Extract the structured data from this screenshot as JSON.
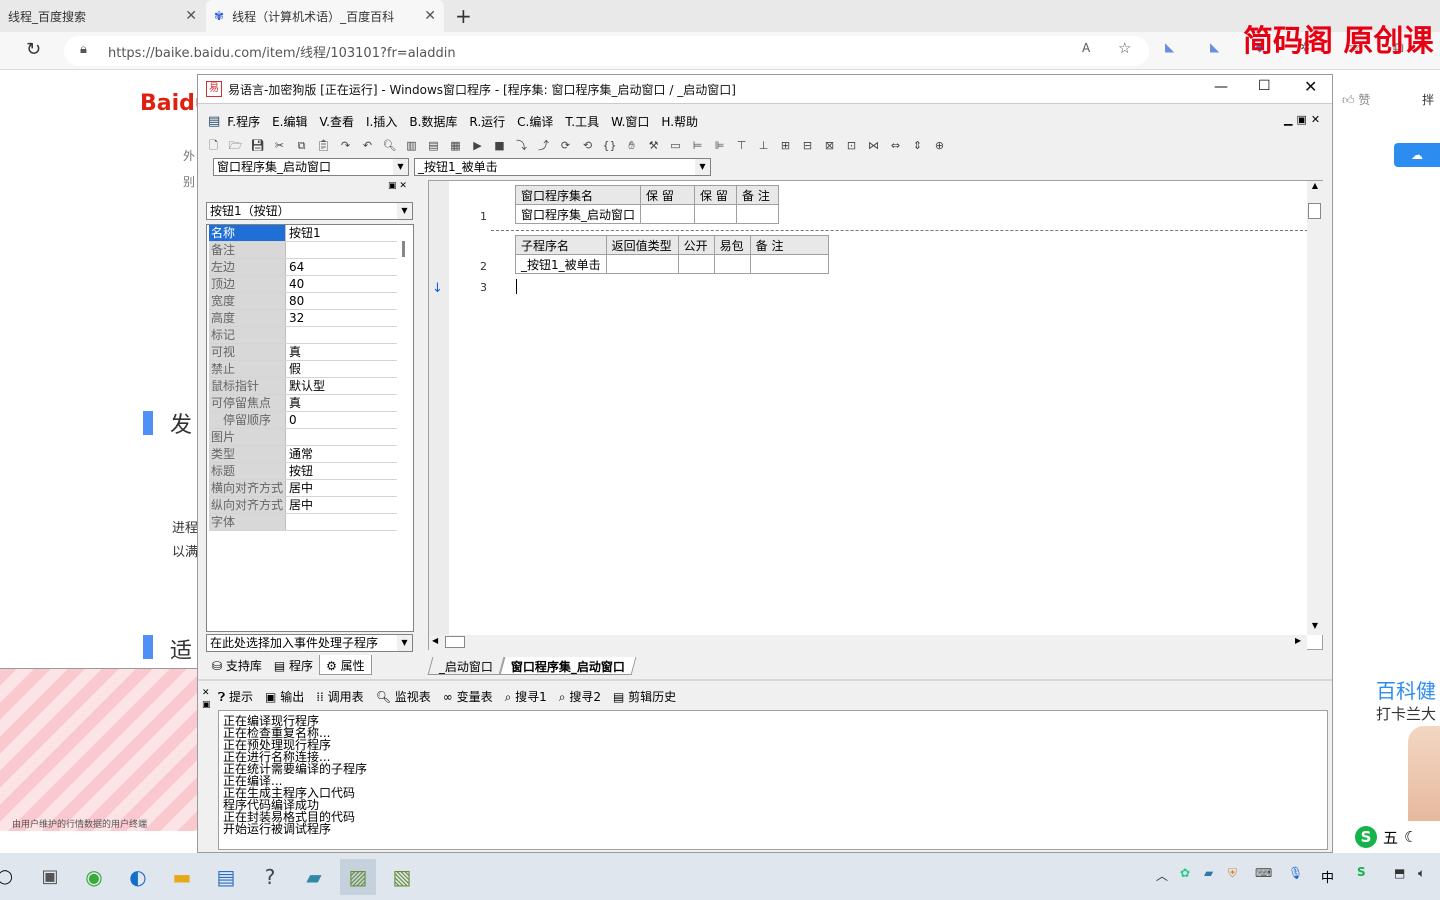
{
  "browser": {
    "tabs": [
      {
        "label": "线程_百度搜索"
      },
      {
        "label": "线程（计算机术语）_百度百科"
      }
    ],
    "url": "https://baike.baidu.com/item/线程/103101?fr=aladdin",
    "watermark": "简码阁 原创课"
  },
  "page": {
    "logo": "Baidu",
    "side_texts": [
      "外",
      "别"
    ],
    "headings": [
      "发",
      "适"
    ],
    "para": [
      "进程",
      "以满"
    ],
    "right_texts": {
      "like": "赞",
      "share": "拌",
      "promo_title": "百科健",
      "promo_sub": "打卡兰大"
    },
    "ad_caption": "由用户维护的行情数据的用户终端"
  },
  "window": {
    "title": "易语言-加密狗版 [正在运行] - Windows窗口程序 - [程序集: 窗口程序集_启动窗口 / _启动窗口]",
    "menu": [
      "F.程序",
      "E.编辑",
      "V.查看",
      "I.插入",
      "B.数据库",
      "R.运行",
      "C.编译",
      "T.工具",
      "W.窗口",
      "H.帮助"
    ],
    "assembly_select": "窗口程序集_启动窗口",
    "sub_select": "_按钮1_被单击",
    "component_select": "按钮1（按钮）",
    "properties": [
      {
        "k": "名称",
        "v": "按钮1"
      },
      {
        "k": "备注",
        "v": ""
      },
      {
        "k": "左边",
        "v": "64"
      },
      {
        "k": "顶边",
        "v": "40"
      },
      {
        "k": "宽度",
        "v": "80"
      },
      {
        "k": "高度",
        "v": "32"
      },
      {
        "k": "标记",
        "v": ""
      },
      {
        "k": "可视",
        "v": "真"
      },
      {
        "k": "禁止",
        "v": "假"
      },
      {
        "k": "鼠标指针",
        "v": "默认型"
      },
      {
        "k": "可停留焦点",
        "v": "真"
      },
      {
        "k": "停留顺序",
        "v": "0"
      },
      {
        "k": "图片",
        "v": ""
      },
      {
        "k": "类型",
        "v": "通常"
      },
      {
        "k": "标题",
        "v": "按钮"
      },
      {
        "k": "横向对齐方式",
        "v": "居中"
      },
      {
        "k": "纵向对齐方式",
        "v": "居中"
      },
      {
        "k": "字体",
        "v": ""
      }
    ],
    "event_select": "在此处选择加入事件处理子程序",
    "left_tabs": [
      "支持库",
      "程序",
      "属性"
    ],
    "assembly_table": {
      "headers": [
        "窗口程序集名",
        "保 留",
        "保 留",
        "备 注"
      ],
      "row": [
        "窗口程序集_启动窗口",
        "",
        "",
        ""
      ]
    },
    "sub_table": {
      "headers": [
        "子程序名",
        "返回值类型",
        "公开",
        "易包",
        "备 注"
      ],
      "row": [
        "_按钮1_被单击",
        "",
        "",
        "",
        ""
      ]
    },
    "line_numbers": [
      "1",
      "2",
      "3"
    ],
    "doc_tabs": [
      "_启动窗口",
      "窗口程序集_启动窗口"
    ],
    "output_tabs": [
      "提示",
      "输出",
      "调用表",
      "监视表",
      "变量表",
      "搜寻1",
      "搜寻2",
      "剪辑历史"
    ],
    "output_lines": [
      "正在编译现行程序",
      "正在检查重复名称...",
      "正在预处理现行程序",
      "正在进行名称连接...",
      "正在统计需要编译的子程序",
      "正在编译...",
      "正在生成主程序入口代码",
      "程序代码编译成功",
      "正在封装易格式目的代码",
      "开始运行被调试程序"
    ]
  },
  "taskbar": {
    "ime": "中",
    "ime2": "五"
  },
  "colors": {
    "accent": "#1e6fd9",
    "watermark": "#e60012",
    "titlebar_bg": "#ffffff"
  }
}
